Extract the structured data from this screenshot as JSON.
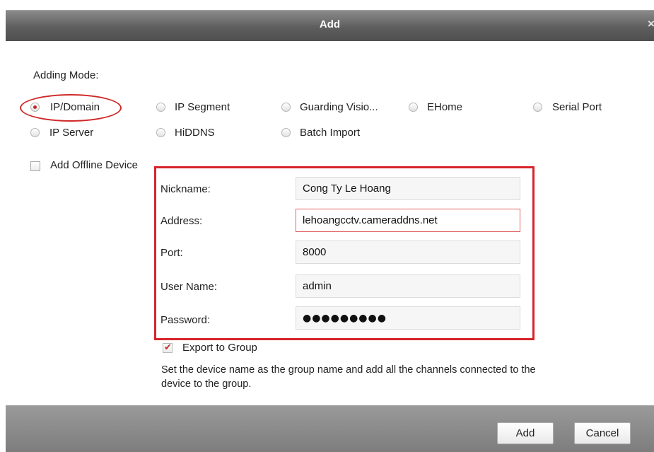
{
  "dialog": {
    "title": "Add",
    "close_glyph": "×"
  },
  "adding_mode": {
    "label": "Adding Mode:",
    "options": [
      "IP/Domain",
      "IP Segment",
      "Guarding Visio...",
      "EHome",
      "Serial Port",
      "IP Server",
      "HiDDNS",
      "Batch Import"
    ],
    "selected": "IP/Domain"
  },
  "offline": {
    "label": "Add Offline Device",
    "checked": false
  },
  "form": {
    "nickname_label": "Nickname:",
    "nickname_value": "Cong Ty Le Hoang",
    "address_label": "Address:",
    "address_value": "lehoangcctv.cameraddns.net",
    "port_label": "Port:",
    "port_value": "8000",
    "username_label": "User Name:",
    "username_value": "admin",
    "password_label": "Password:",
    "password_value": "●●●●●●●●●"
  },
  "export": {
    "label": "Export to Group",
    "checked": true,
    "description": "Set the device name as the group name and add all the channels connected to the device to the group."
  },
  "buttons": {
    "add": "Add",
    "cancel": "Cancel"
  },
  "colors": {
    "accent_red": "#d6242b",
    "titlebar": "#666666",
    "footer": "#8a8a8a"
  },
  "icons": {
    "close": "close-icon",
    "check": "checkmark-icon"
  }
}
